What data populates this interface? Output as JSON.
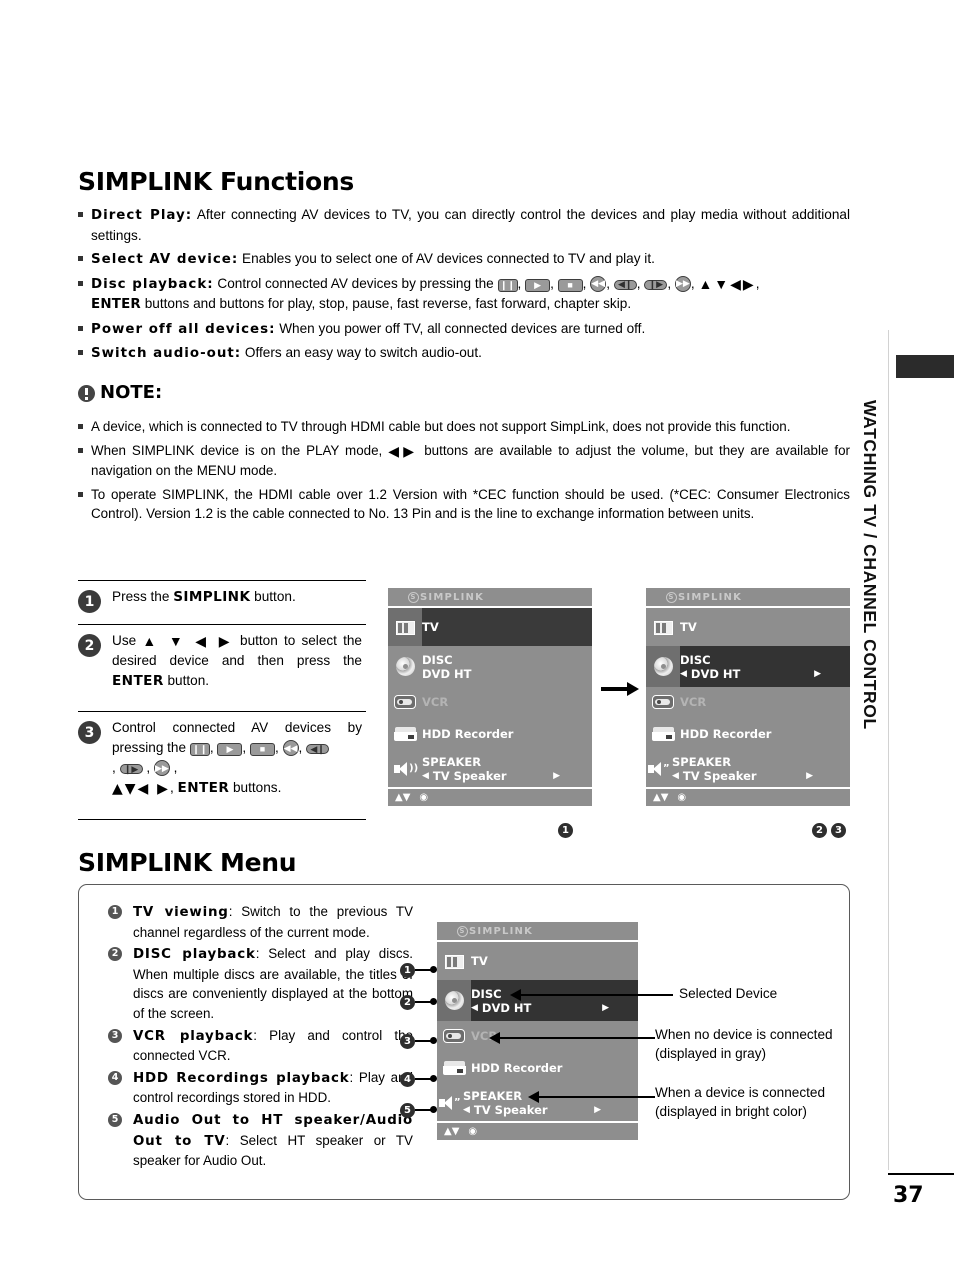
{
  "page": {
    "number": "37",
    "side_tab": "WATCHING TV / CHANNEL CONTROL"
  },
  "functions_section": {
    "title": "SIMPLINK Functions",
    "items": [
      {
        "label": "Direct Play:",
        "text": " After connecting AV devices to TV, you can directly control the devices and play media without additional settings."
      },
      {
        "label": "Select AV device:",
        "text": " Enables you to select one of AV devices connected to TV and play it."
      },
      {
        "label": "Disc playback:",
        "text_before": " Control connected AV devices by pressing the ",
        "text_after": " buttons and buttons for play, stop, pause, fast reverse, fast forward, chapter skip.",
        "enter_label": "ENTER",
        "icons": [
          "pause-button-icon",
          "play-button-icon",
          "stop-button-icon",
          "fast-reverse-button-icon",
          "skip-back-button-icon",
          "skip-forward-button-icon",
          "fast-forward-button-icon",
          "arrow-up-icon",
          "arrow-down-icon",
          "arrow-left-icon",
          "arrow-right-icon"
        ]
      },
      {
        "label": "Power off all devices:",
        "text": " When you power off TV, all connected devices are turned off."
      },
      {
        "label": "Switch audio-out:",
        "text": " Offers an easy way to switch audio-out."
      }
    ]
  },
  "note_section": {
    "heading": "NOTE:",
    "icon": "exclamation-circle-icon",
    "items": [
      "A device, which is connected to TV through HDMI cable but does not support SimpLink, does not provide this function.",
      {
        "before": "When SIMPLINK device is on the PLAY mode, ",
        "after": " buttons are available to adjust the volume, but they are available for navigation on the MENU mode."
      },
      "To operate SIMPLINK, the HDMI cable over 1.2 Version with *CEC function should be used. (*CEC: Consumer Electronics Control). Version 1.2 is the cable connected to  No. 13 Pin and is the line to exchange information between units."
    ]
  },
  "steps": [
    {
      "num": "1",
      "before": "Press the ",
      "bold": "SIMPLINK",
      "after": " button."
    },
    {
      "num": "2",
      "before": "Use ",
      "arrows": "▲ ▼ ◀ ▶",
      "mid": " button to select the desired device and then press the ",
      "bold": "ENTER",
      "after": " button."
    },
    {
      "num": "3",
      "before": "Control connected AV devices by pressing the ",
      "arrows": "▲▼◀ ▶",
      "bold": "ENTER",
      "after": " buttons."
    }
  ],
  "osd_panels": {
    "logo": "SIMPLINK",
    "logo_mark": "S",
    "panel1": {
      "marker": "1",
      "rows": [
        {
          "label": "TV",
          "state": "selected",
          "icon": "tv-icon"
        },
        {
          "label_top": "DISC",
          "label_bottom": "DVD HT",
          "state": "normal",
          "icon": "disc-icon"
        },
        {
          "label": "VCR",
          "state": "disabled",
          "icon": "vcr-icon"
        },
        {
          "label": "HDD Recorder",
          "state": "normal",
          "icon": "hdd-recorder-icon"
        },
        {
          "label_top": "SPEAKER",
          "label_bottom": "TV Speaker",
          "state": "normal",
          "icon": "speaker-icon",
          "left_arrow": "◀",
          "right_arrow": "▶"
        }
      ],
      "footer": {
        "updown": "▲▼",
        "enter": "◉"
      }
    },
    "panel2": {
      "markers": [
        "2",
        "3"
      ],
      "rows": [
        {
          "label": "TV",
          "state": "normal",
          "icon": "tv-icon"
        },
        {
          "label_top": "DISC",
          "label_bottom": "DVD HT",
          "state": "selected",
          "icon": "disc-icon",
          "left_arrow": "◀",
          "right_arrow": "▶"
        },
        {
          "label": "VCR",
          "state": "disabled",
          "icon": "vcr-icon"
        },
        {
          "label": "HDD Recorder",
          "state": "normal",
          "icon": "hdd-recorder-icon"
        },
        {
          "label_top": "SPEAKER",
          "label_bottom": "TV Speaker",
          "state": "normal",
          "icon": "speaker-icon",
          "left_arrow": "◀",
          "right_arrow": "▶"
        }
      ],
      "footer": {
        "updown": "▲▼",
        "enter": "◉"
      }
    },
    "panel3": {
      "rows": [
        {
          "label": "TV",
          "state": "normal",
          "icon": "tv-icon",
          "marker": "1"
        },
        {
          "label_top": "DISC",
          "label_bottom": "DVD HT",
          "state": "selected",
          "icon": "disc-icon",
          "marker": "2",
          "left_arrow": "◀",
          "right_arrow": "▶"
        },
        {
          "label": "VCR",
          "state": "disabled",
          "icon": "vcr-icon",
          "marker": "3"
        },
        {
          "label": "HDD Recorder",
          "state": "normal",
          "icon": "hdd-recorder-icon",
          "marker": "4"
        },
        {
          "label_top": "SPEAKER",
          "label_bottom": "TV Speaker",
          "state": "normal",
          "icon": "speaker-icon",
          "marker": "5",
          "left_arrow": "◀",
          "right_arrow": "▶"
        }
      ],
      "footer": {
        "updown": "▲▼",
        "enter": "◉"
      }
    }
  },
  "menu_section": {
    "title": "SIMPLINK Menu",
    "items": [
      {
        "num": "1",
        "label": "TV viewing",
        "text": ": Switch to the previous TV channel regardless of the current mode."
      },
      {
        "num": "2",
        "label": "DISC playback",
        "text": ": Select and play discs. When multiple discs are available, the titles of discs are conveniently displayed at the bottom of the screen."
      },
      {
        "num": "3",
        "label": "VCR playback",
        "text": ": Play and control the connected VCR."
      },
      {
        "num": "4",
        "label": "HDD Recordings playback",
        "text": ": Play and control recordings stored in HDD."
      },
      {
        "num": "5",
        "label": "Audio Out to HT speaker/Audio Out to TV",
        "text": ": Select HT speaker or TV speaker for Audio Out."
      }
    ],
    "callouts": [
      {
        "text": "Selected  Device"
      },
      {
        "line1": "When no device is connected",
        "line2": "(displayed in gray)"
      },
      {
        "line1": "When a device is connected",
        "line2": "(displayed in bright color)"
      }
    ]
  }
}
